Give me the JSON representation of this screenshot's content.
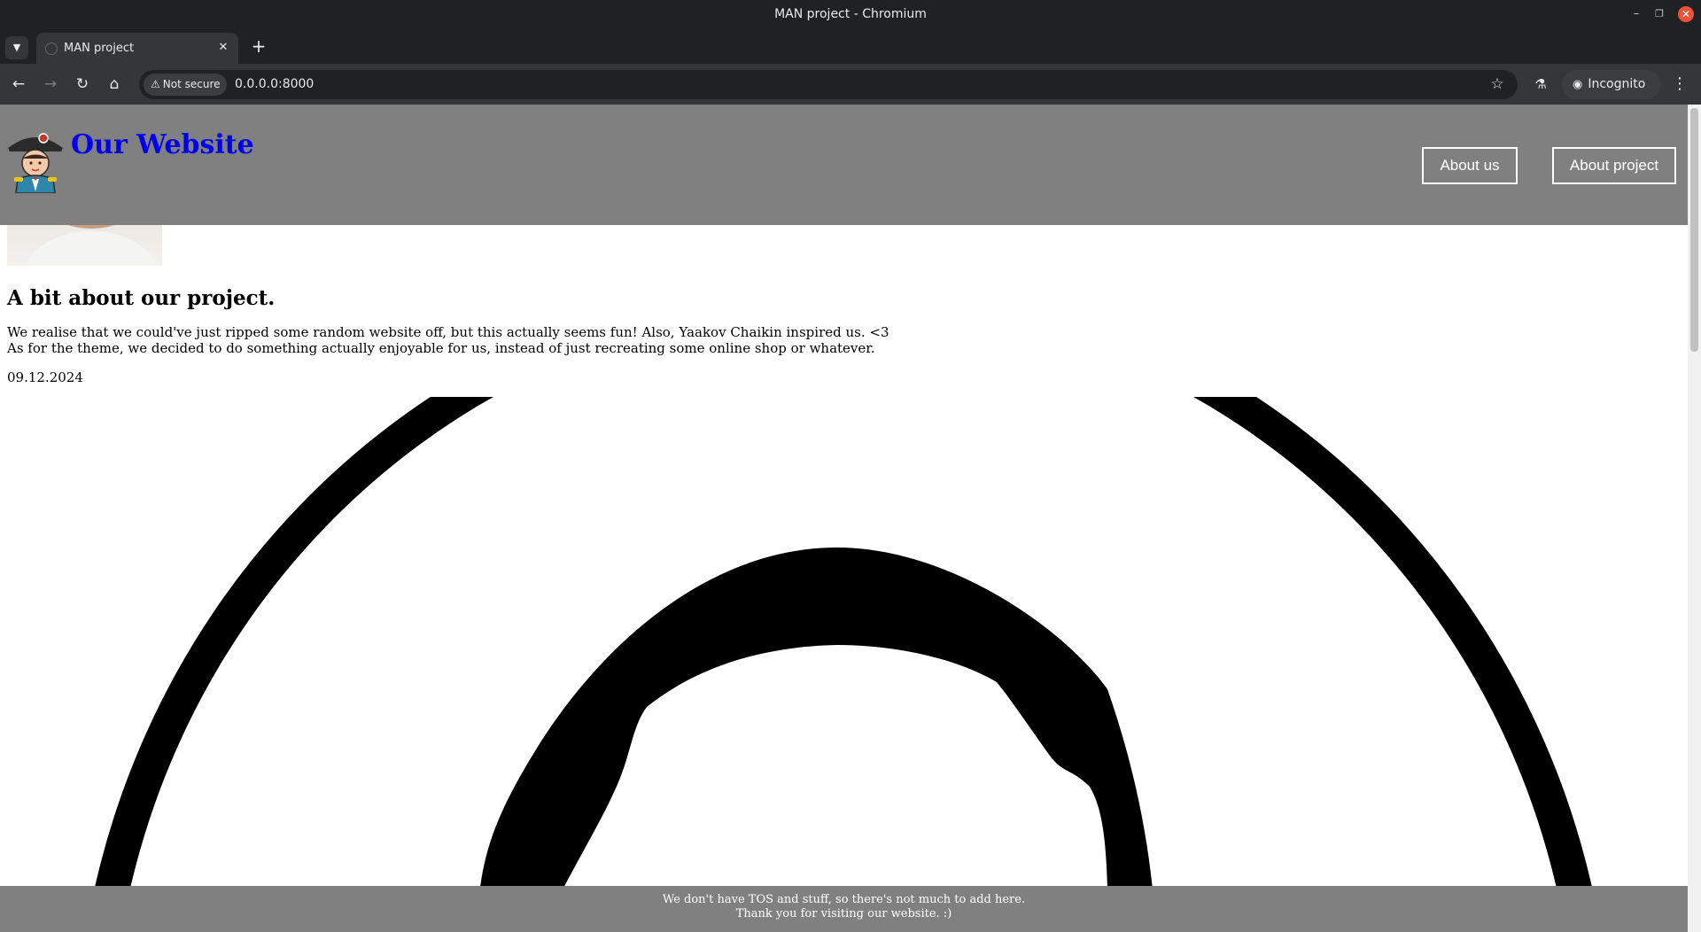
{
  "window": {
    "title": "MAN project - Chromium"
  },
  "tabs": [
    {
      "title": "MAN project"
    }
  ],
  "toolbar": {
    "security_label": "Not secure",
    "url": "0.0.0.0:8000",
    "incognito_label": "Incognito"
  },
  "site": {
    "title": "Our Website",
    "nav": [
      {
        "label": "About us"
      },
      {
        "label": "About project"
      }
    ]
  },
  "article": {
    "heading": "A bit about our project.",
    "line1": "We realise that we could've just ripped some random website off, but this actually seems fun! Also, Yaakov Chaikin inspired us. <3",
    "line2": "As for the theme, we decided to do something actually enjoyable for us, instead of just recreating some online shop or whatever.",
    "date": "09.12.2024"
  },
  "footer": {
    "line1": "We don't have TOS and stuff, so there's not much to add here.",
    "line2": "Thank you for visiting our website. :)"
  },
  "icons": {
    "back": "arrow-left-icon",
    "forward": "arrow-right-icon",
    "reload": "reload-icon",
    "home": "home-icon",
    "bookmark": "star-icon",
    "labs": "flask-icon",
    "menu": "kebab-menu-icon"
  },
  "colors": {
    "header_bg": "#808080",
    "title_link": "#0000ee",
    "chrome_dark": "#202124",
    "chrome_toolbar": "#35363a"
  }
}
